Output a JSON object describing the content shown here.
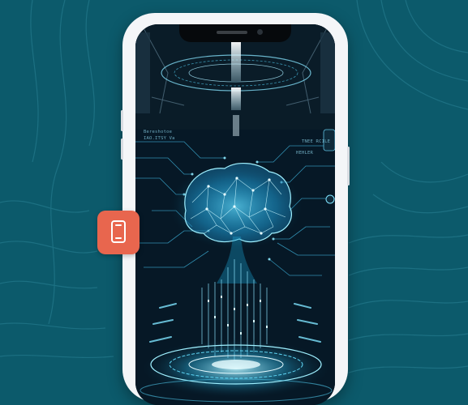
{
  "colors": {
    "background": "#0c5a6b",
    "phone_frame": "#f4f6f8",
    "screen": "#03111c",
    "accent_glow": "#5fe4ff",
    "badge": "#e8664e"
  },
  "screen": {
    "illustration": "ai-brain-hologram",
    "hud_labels": [
      "Bereshotoe",
      "IAO.ITSY Va",
      "TNEE RCILE",
      "HEHLER"
    ]
  },
  "floating_badge": {
    "icon": "mobile-device-icon"
  }
}
